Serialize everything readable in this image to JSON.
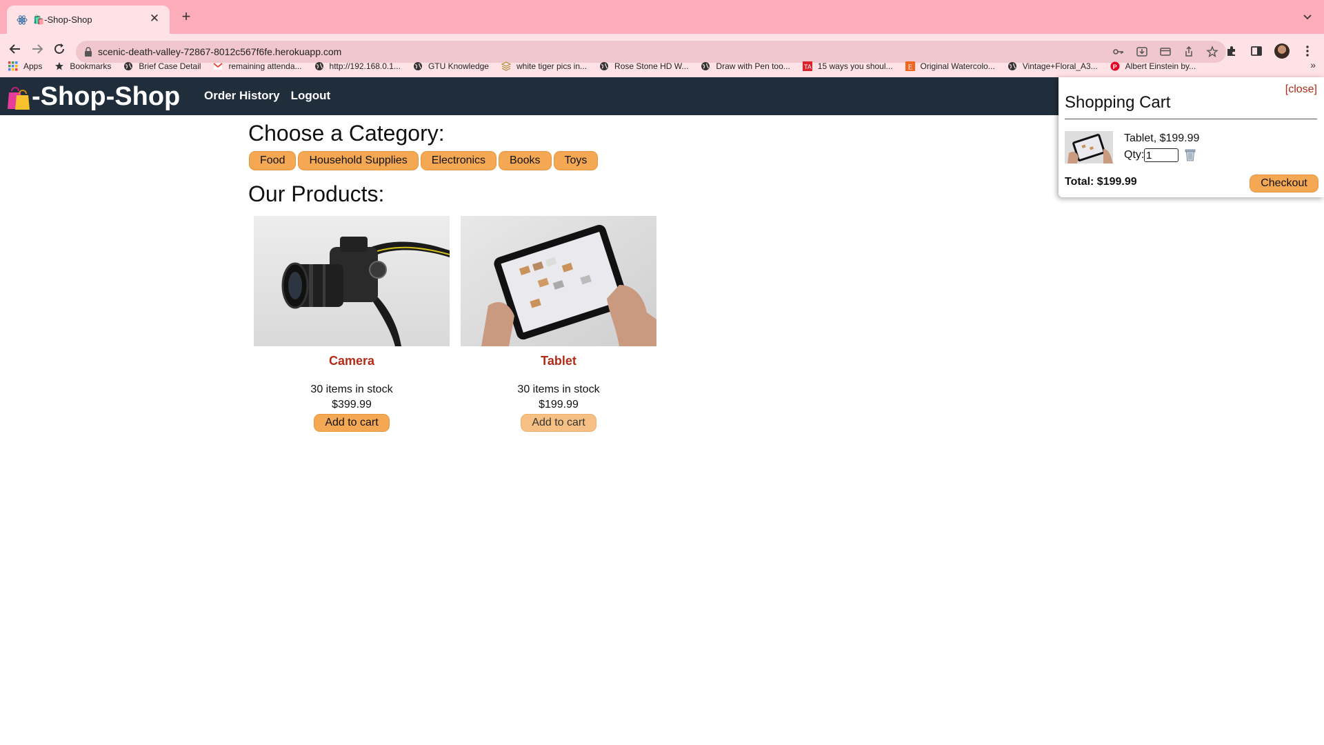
{
  "browser": {
    "tab_title": "🛍️-Shop-Shop",
    "url": "scenic-death-valley-72867-8012c567f6fe.herokuapp.com",
    "bookmarks": [
      {
        "label": "Apps",
        "icon": "apps-grid-icon"
      },
      {
        "label": "Bookmarks",
        "icon": "star-icon"
      },
      {
        "label": "Brief Case Detail",
        "icon": "globe-icon"
      },
      {
        "label": "remaining attenda...",
        "icon": "gmail-icon"
      },
      {
        "label": "http://192.168.0.1...",
        "icon": "globe-icon"
      },
      {
        "label": "GTU Knowledge",
        "icon": "globe-icon"
      },
      {
        "label": "white tiger pics in...",
        "icon": "layers-icon"
      },
      {
        "label": "Rose Stone HD W...",
        "icon": "globe-icon"
      },
      {
        "label": "Draw with Pen too...",
        "icon": "globe-icon"
      },
      {
        "label": "15 ways you shoul...",
        "icon": "ta-icon"
      },
      {
        "label": "Original Watercolo...",
        "icon": "etsy-icon"
      },
      {
        "label": "Vintage+Floral_A3...",
        "icon": "globe-icon"
      },
      {
        "label": "Albert Einstein by...",
        "icon": "pinterest-icon"
      }
    ],
    "more_bookmarks": "»"
  },
  "header": {
    "logo_text": "-Shop-Shop",
    "nav": {
      "order_history": "Order History",
      "logout": "Logout"
    }
  },
  "main": {
    "category_heading": "Choose a Category:",
    "categories": [
      "Food",
      "Household Supplies",
      "Electronics",
      "Books",
      "Toys"
    ],
    "products_heading": "Our Products:",
    "products": [
      {
        "name": "Camera",
        "stock": "30 items in stock",
        "price": "$399.99",
        "button": "Add to cart"
      },
      {
        "name": "Tablet",
        "stock": "30 items in stock",
        "price": "$199.99",
        "button": "Add to cart"
      }
    ]
  },
  "cart": {
    "close_label": "[close]",
    "title": "Shopping Cart",
    "items": [
      {
        "name_price": "Tablet, $199.99",
        "qty_label": "Qty:",
        "qty": "1"
      }
    ],
    "total": "Total: $199.99",
    "checkout_label": "Checkout"
  },
  "colors": {
    "tabstrip": "#fcadb9",
    "toolbar": "#ffe2e6",
    "app_header": "#202e3c",
    "accent_button": "#f5a854",
    "product_name": "#b32a15"
  }
}
